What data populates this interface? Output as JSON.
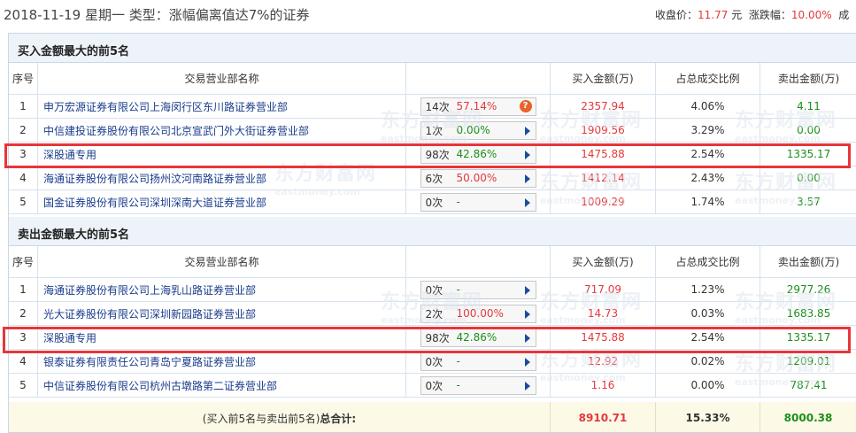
{
  "header": {
    "date_line": "2018-11-19 星期一  类型：涨幅偏离值达7%的证券",
    "close_label": "收盘价：",
    "close_value": "11.77",
    "close_unit": "元",
    "change_label": "涨跌幅：",
    "change_value": "10.00%",
    "trailing": "成"
  },
  "columns": {
    "no": "序号",
    "name": "交易营业部名称",
    "buy": "买入金额(万)",
    "pct": "占总成交比例",
    "sell": "卖出金额(万)"
  },
  "buy_section": {
    "title": "买入金额最大的前5名",
    "rows": [
      {
        "no": "1",
        "name": "申万宏源证券有限公司上海闵行区东川路证券营业部",
        "times": "14次",
        "rate": "57.14%",
        "rate_up": true,
        "bubble": "?",
        "buy": "2357.94",
        "pct": "4.06%",
        "sell": "4.11"
      },
      {
        "no": "2",
        "name": "中信建投证券股份有限公司北京宣武门外大街证券营业部",
        "times": "1次",
        "rate": "0.00%",
        "rate_up": false,
        "bubble": "",
        "buy": "1909.56",
        "pct": "3.29%",
        "sell": "0.00"
      },
      {
        "no": "3",
        "name": "深股通专用",
        "times": "98次",
        "rate": "42.86%",
        "rate_up": false,
        "bubble": "",
        "buy": "1475.88",
        "pct": "2.54%",
        "sell": "1335.17"
      },
      {
        "no": "4",
        "name": "海通证券股份有限公司扬州汶河南路证券营业部",
        "times": "6次",
        "rate": "50.00%",
        "rate_up": true,
        "bubble": "",
        "buy": "1412.14",
        "pct": "2.43%",
        "sell": "0.00"
      },
      {
        "no": "5",
        "name": "国金证券股份有限公司深圳深南大道证券营业部",
        "times": "0次",
        "rate": "-",
        "rate_up": false,
        "bubble": "",
        "buy": "1009.29",
        "pct": "1.74%",
        "sell": "3.57"
      }
    ]
  },
  "sell_section": {
    "title": "卖出金额最大的前5名",
    "rows": [
      {
        "no": "1",
        "name": "海通证券股份有限公司上海乳山路证券营业部",
        "times": "0次",
        "rate": "-",
        "rate_up": false,
        "bubble": "",
        "buy": "717.09",
        "pct": "1.23%",
        "sell": "2977.26"
      },
      {
        "no": "2",
        "name": "光大证券股份有限公司深圳新园路证券营业部",
        "times": "2次",
        "rate": "100.00%",
        "rate_up": true,
        "bubble": "",
        "buy": "14.73",
        "pct": "0.03%",
        "sell": "1683.85"
      },
      {
        "no": "3",
        "name": "深股通专用",
        "times": "98次",
        "rate": "42.86%",
        "rate_up": false,
        "bubble": "",
        "buy": "1475.88",
        "pct": "2.54%",
        "sell": "1335.17"
      },
      {
        "no": "4",
        "name": "银泰证券有限责任公司青岛宁夏路证券营业部",
        "times": "0次",
        "rate": "-",
        "rate_up": false,
        "bubble": "",
        "buy": "12.92",
        "pct": "0.02%",
        "sell": "1209.01"
      },
      {
        "no": "5",
        "name": "中信证券股份有限公司杭州古墩路第二证券营业部",
        "times": "0次",
        "rate": "-",
        "rate_up": false,
        "bubble": "",
        "buy": "1.16",
        "pct": "0.00%",
        "sell": "787.41"
      }
    ]
  },
  "totals": {
    "label_prefix": "(买入前5名与卖出前5名)",
    "label_bold": "总合计:",
    "buy": "8910.71",
    "pct": "15.33%",
    "sell": "8000.38"
  },
  "watermark": {
    "text": "东方财富网",
    "sub": "eastmoney.com"
  },
  "colors": {
    "up": "#e4393c",
    "down": "#1a8f1a",
    "link": "#1a3c8c",
    "highlight": "#e8353a",
    "section_bg": "#eef3f9",
    "total_bg": "#fdf9e7"
  },
  "icons": {
    "detail_arrow": "right-triangle-icon",
    "tip": "question-bubble-icon"
  }
}
